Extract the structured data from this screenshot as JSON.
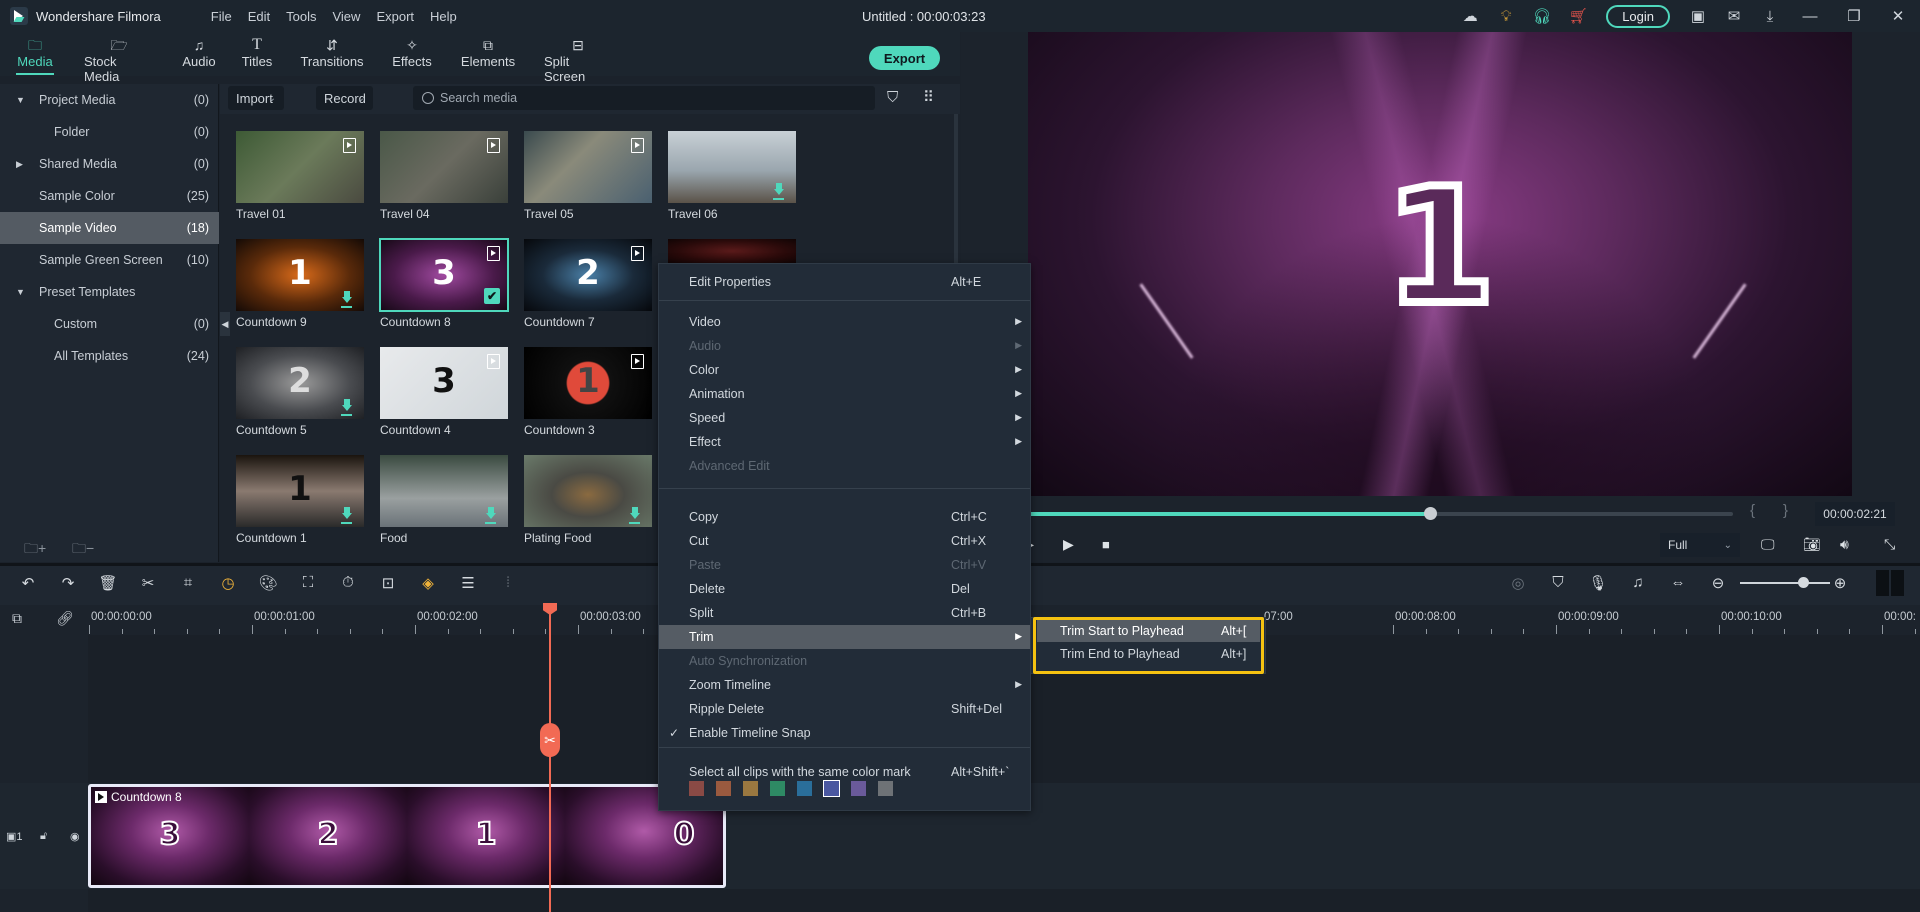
{
  "app": {
    "name": "Wondershare Filmora",
    "window_title": "Untitled : 00:00:03:23",
    "menu": [
      "File",
      "Edit",
      "Tools",
      "View",
      "Export",
      "Help"
    ],
    "login_label": "Login",
    "top_icons": [
      "cloud-icon",
      "lightbulb-icon",
      "headset-icon",
      "cart-icon"
    ],
    "window_icons": [
      "save-icon",
      "mail-icon",
      "download-icon",
      "minimize-icon",
      "restore-icon",
      "close-icon"
    ]
  },
  "nav_tabs": [
    {
      "label": "Media",
      "icon": "folder-icon",
      "active": true
    },
    {
      "label": "Stock Media",
      "icon": "cloud-folder-icon",
      "active": false
    },
    {
      "label": "Audio",
      "icon": "music-note-icon",
      "active": false
    },
    {
      "label": "Titles",
      "icon": "text-icon",
      "active": false
    },
    {
      "label": "Transitions",
      "icon": "transition-icon",
      "active": false
    },
    {
      "label": "Effects",
      "icon": "sparkle-icon",
      "active": false
    },
    {
      "label": "Elements",
      "icon": "layers-icon",
      "active": false
    },
    {
      "label": "Split Screen",
      "icon": "split-screen-icon",
      "active": false
    }
  ],
  "export_label": "Export",
  "sidebar": {
    "items": [
      {
        "label": "Project Media",
        "count": "(0)",
        "expander": "down",
        "indent": 0
      },
      {
        "label": "Folder",
        "count": "(0)",
        "expander": "",
        "indent": 1
      },
      {
        "label": "Shared Media",
        "count": "(0)",
        "expander": "right",
        "indent": 0
      },
      {
        "label": "Sample Color",
        "count": "(25)",
        "expander": "",
        "indent": 0
      },
      {
        "label": "Sample Video",
        "count": "(18)",
        "expander": "",
        "indent": 0,
        "selected": true
      },
      {
        "label": "Sample Green Screen",
        "count": "(10)",
        "expander": "",
        "indent": 0
      },
      {
        "label": "Preset Templates",
        "count": "",
        "expander": "down",
        "indent": 0
      },
      {
        "label": "Custom",
        "count": "(0)",
        "expander": "",
        "indent": 1
      },
      {
        "label": "All Templates",
        "count": "(24)",
        "expander": "",
        "indent": 1
      }
    ]
  },
  "media_toolbar": {
    "import_label": "Import",
    "record_label": "Record",
    "search_placeholder": "Search media"
  },
  "media_items": [
    {
      "label": "Travel 01",
      "badge": "film"
    },
    {
      "label": "Travel 04",
      "badge": "film"
    },
    {
      "label": "Travel 05",
      "badge": "film"
    },
    {
      "label": "Travel 06",
      "badge": "download"
    },
    {
      "label": "Countdown 9",
      "badge": "download"
    },
    {
      "label": "Countdown 8",
      "badge": "film",
      "selected": true,
      "checked": true
    },
    {
      "label": "Countdown 7",
      "badge": "film"
    },
    {
      "label": "",
      "badge": ""
    },
    {
      "label": "Countdown 5",
      "badge": "download"
    },
    {
      "label": "Countdown 4",
      "badge": "film"
    },
    {
      "label": "Countdown 3",
      "badge": "film"
    },
    {
      "label": "Countdown 1",
      "badge": "download"
    },
    {
      "label": "Food",
      "badge": "download"
    },
    {
      "label": "Plating Food",
      "badge": "download"
    }
  ],
  "preview": {
    "frame_number": "1",
    "timecode": "00:00:02:21",
    "progress_fraction": 0.57,
    "quality": "Full"
  },
  "timeline": {
    "ruler_labels": [
      "00:00:00:00",
      "00:00:01:00",
      "00:00:02:00",
      "00:00:03:00",
      "07:00",
      "00:00:08:00",
      "00:00:09:00",
      "00:00:10:00",
      "00:00:"
    ],
    "track_label": "1",
    "clip": {
      "label": "Countdown 8",
      "frames": [
        "3",
        "2",
        "1",
        "0"
      ]
    },
    "zoom_fraction": 0.7
  },
  "context_menu": {
    "items": [
      {
        "label": "Edit Properties",
        "shortcut": "Alt+E"
      },
      {
        "sep": true
      },
      {
        "label": "Video",
        "submenu": true
      },
      {
        "label": "Audio",
        "submenu": true,
        "disabled": true
      },
      {
        "label": "Color",
        "submenu": true
      },
      {
        "label": "Animation",
        "submenu": true
      },
      {
        "label": "Speed",
        "submenu": true
      },
      {
        "label": "Effect",
        "submenu": true
      },
      {
        "label": "Advanced Edit",
        "disabled": true
      },
      {
        "sep": true
      },
      {
        "label": "Copy",
        "shortcut": "Ctrl+C"
      },
      {
        "label": "Cut",
        "shortcut": "Ctrl+X"
      },
      {
        "label": "Paste",
        "shortcut": "Ctrl+V",
        "disabled": true
      },
      {
        "label": "Delete",
        "shortcut": "Del"
      },
      {
        "label": "Split",
        "shortcut": "Ctrl+B"
      },
      {
        "label": "Trim",
        "submenu": true,
        "highlighted": true
      },
      {
        "label": "Auto Synchronization",
        "disabled": true
      },
      {
        "label": "Zoom Timeline",
        "submenu": true
      },
      {
        "label": "Ripple Delete",
        "shortcut": "Shift+Del"
      },
      {
        "label": "Enable Timeline Snap",
        "checked": true
      },
      {
        "sep": true
      },
      {
        "label": "Select all clips with the same color mark",
        "shortcut": "Alt+Shift+`"
      }
    ],
    "color_marks": [
      "#8a4a45",
      "#9a5a3f",
      "#9a7840",
      "#2e8a64",
      "#2a6e9a",
      "#4a57a0",
      "#6a5a9a",
      "#6e7276"
    ],
    "selected_color_index": 5
  },
  "trim_submenu": {
    "items": [
      {
        "label": "Trim Start to Playhead",
        "shortcut": "Alt+[",
        "highlighted": true
      },
      {
        "label": "Trim End to Playhead",
        "shortcut": "Alt+]"
      }
    ],
    "highlight_color": "#f5c211"
  },
  "colors": {
    "accent": "#4fd8bc",
    "playhead": "#f26a54"
  }
}
